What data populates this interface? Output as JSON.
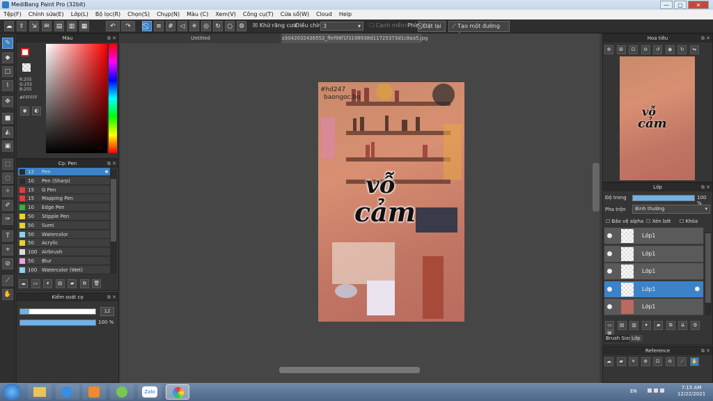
{
  "window": {
    "title": "MediBang Paint Pro (32bit)",
    "min": "—",
    "max": "▢",
    "close": "✕"
  },
  "menu": [
    "Tệp(F)",
    "Chỉnh sửa(E)",
    "Lớp(L)",
    "Bộ lọc(R)",
    "Chọn(S)",
    "Chụp(N)",
    "Màu (C)",
    "Xem(V)",
    "Công cụ(T)",
    "Cửa sổ(W)",
    "Cloud",
    "Help"
  ],
  "toolbar": {
    "antialias_label": "Khử răng cưa",
    "adjust_label": "Điều chỉnh",
    "adjust_value": "3",
    "soft_edge_label": "Cạnh mềm",
    "key_label": "Phím",
    "reset_label": "Đặt lại",
    "straight_line_label": "Tạo một đường thẳng"
  },
  "color_panel": {
    "title": "Màu",
    "rgb": "R:255\nG:255\nB:255",
    "hex": "#FFFFFF",
    "accent": "#3b82c8"
  },
  "brush_panel": {
    "title": "Cọ: Pen",
    "brushes": [
      {
        "size": "12",
        "name": "Pen",
        "color": "#2b2b2b",
        "selected": true
      },
      {
        "size": "10",
        "name": "Pen (Sharp)",
        "color": "#2b2b2b"
      },
      {
        "size": "15",
        "name": "G Pen",
        "color": "#e33b3b"
      },
      {
        "size": "15",
        "name": "Mapping Pen",
        "color": "#e33b3b"
      },
      {
        "size": "10",
        "name": "Edge Pen",
        "color": "#2fb52f"
      },
      {
        "size": "50",
        "name": "Stipple Pen",
        "color": "#e8d22b"
      },
      {
        "size": "50",
        "name": "Sumi",
        "color": "#e8d22b"
      },
      {
        "size": "50",
        "name": "Watercolor",
        "color": "#8fd0f0"
      },
      {
        "size": "50",
        "name": "Acrylic",
        "color": "#e8d22b"
      },
      {
        "size": "100",
        "name": "Airbrush",
        "color": "#dddddd"
      },
      {
        "size": "50",
        "name": "Blur",
        "color": "#f0a0e0"
      },
      {
        "size": "100",
        "name": "Watercolor (Wet)",
        "color": "#8fd0f0"
      }
    ]
  },
  "control_panel": {
    "title": "Kiểm soát cọ",
    "size_value": "12",
    "opacity_value": "100 %",
    "size_fraction": 0.12,
    "opacity_fraction": 1.0
  },
  "canvas": {
    "tab_untitled": "Untitled",
    "tab_file": "z3042032436552_ffef98f1f3198938d11725373d1c8aa5.jpg",
    "artwork_caption_1": "#hd247",
    "artwork_caption_2": "baongoc.bn",
    "artwork_title_line1": "vỗ",
    "artwork_title_line2": "cảm"
  },
  "navigator": {
    "title": "Hoa tiêu"
  },
  "layer_panel": {
    "title": "Lớp",
    "opacity_label": "Độ trong",
    "opacity_value": "100 %",
    "blend_label": "Pha trộn",
    "blend_value": "Bình thường",
    "protect_alpha": "Bảo vệ alpha",
    "clip": "Xén bớt",
    "lock": "Khóa",
    "layers": [
      {
        "name": "Lớp1"
      },
      {
        "name": "Lớp1"
      },
      {
        "name": "Lớp1"
      },
      {
        "name": "Lớp1",
        "selected": true
      },
      {
        "name": "Lớp1"
      }
    ],
    "tab_brush_size": "Brush Size",
    "tab_layer": "Lớp"
  },
  "reference_panel": {
    "title": "Reference"
  },
  "taskbar": {
    "lang": "EN",
    "time": "7:15 AM",
    "date": "12/22/2021",
    "zalo": "Zalo"
  }
}
